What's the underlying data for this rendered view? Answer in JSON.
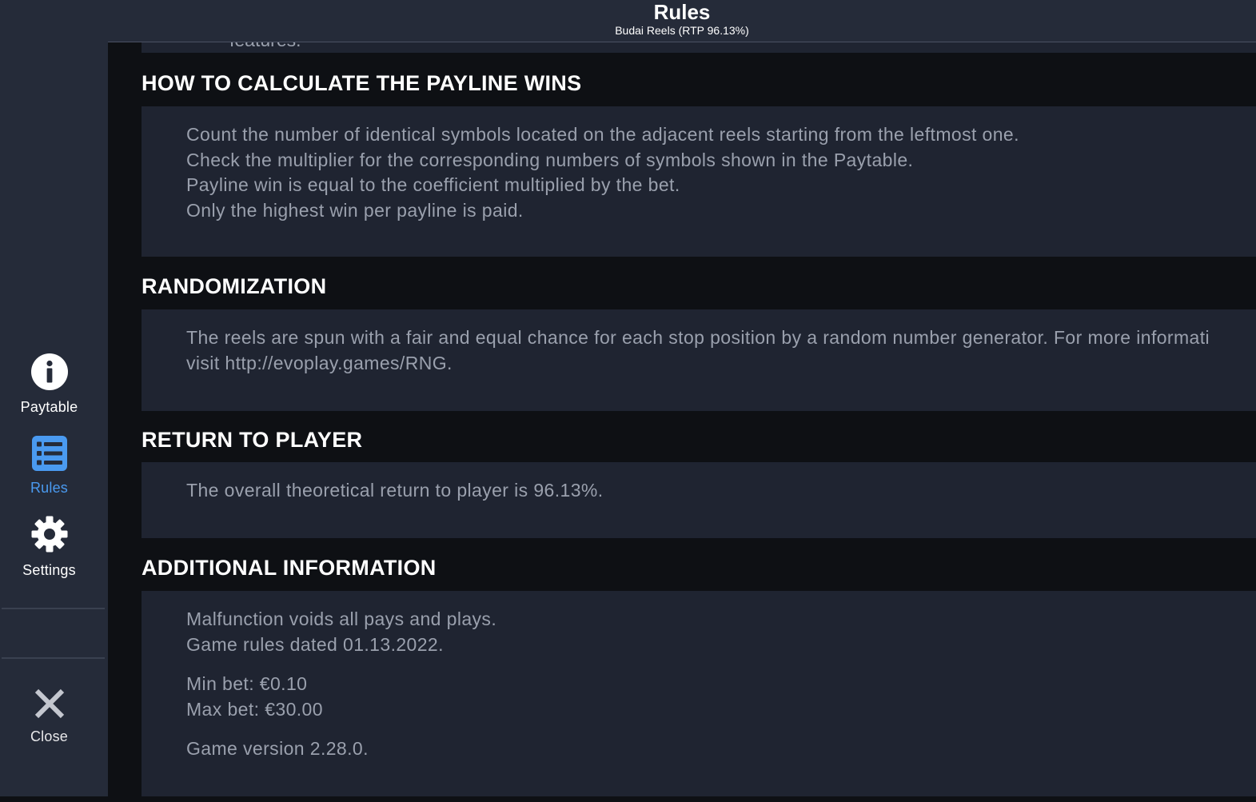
{
  "header": {
    "title": "Rules",
    "subtitle": "Budai Reels (RTP 96.13%)"
  },
  "sidebar": {
    "items": [
      {
        "label": "Paytable",
        "icon": "info-icon"
      },
      {
        "label": "Rules",
        "icon": "list-icon",
        "active": true
      },
      {
        "label": "Settings",
        "icon": "gear-icon"
      }
    ],
    "close_label": "Close"
  },
  "colors": {
    "accent": "#4a9af0",
    "sidebar_bg": "#252b39",
    "panel_bg": "#1f2431",
    "text_muted": "#9aa0ad"
  },
  "content": {
    "cut_text": "features.",
    "sections": [
      {
        "title": "HOW TO CALCULATE THE PAYLINE WINS",
        "lines": [
          "Count the number of identical symbols located on the adjacent reels starting from the leftmost one.",
          "Check the multiplier for the corresponding numbers of symbols shown in the Paytable.",
          "Payline win is equal to the coefficient multiplied by the bet.",
          "Only the highest win per payline is paid."
        ]
      },
      {
        "title": "RANDOMIZATION",
        "lines": [
          "The reels are spun with a fair and equal chance for each stop position by a random number generator. For more informati",
          "visit http://evoplay.games/RNG."
        ]
      },
      {
        "title": "RETURN TO PLAYER",
        "lines": [
          "The overall theoretical return to player is 96.13%."
        ]
      },
      {
        "title": "ADDITIONAL INFORMATION",
        "lines": [
          "Malfunction voids all pays and plays.",
          "Game rules dated 01.13.2022.",
          "Min bet: €0.10",
          "Max bet: €30.00",
          "Game version 2.28.0."
        ]
      }
    ]
  }
}
